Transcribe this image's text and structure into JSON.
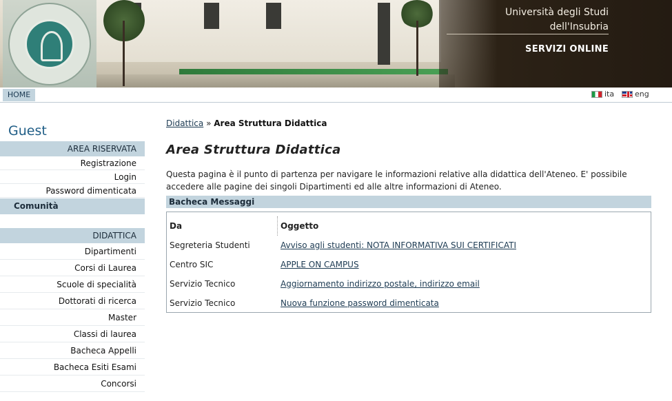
{
  "header": {
    "university_line1": "Università degli Studi",
    "university_line2": "dell'Insubria",
    "services": "SERVIZI ONLINE"
  },
  "nav": {
    "home": "HOME",
    "lang_it": "ita",
    "lang_en": "eng"
  },
  "sidebar": {
    "user": "Guest",
    "area_riservata": "AREA RISERVATA",
    "area_items": [
      "Registrazione",
      "Login",
      "Password dimenticata"
    ],
    "comunita": "Comunità",
    "didattica": "DIDATTICA",
    "didattica_items": [
      "Dipartimenti",
      "Corsi di Laurea",
      "Scuole di specialità",
      "Dottorati di ricerca",
      "Master",
      "Classi di laurea",
      "Bacheca Appelli",
      "Bacheca Esiti Esami",
      "Concorsi"
    ]
  },
  "main": {
    "breadcrumb_link": "Didattica",
    "breadcrumb_sep": "»",
    "breadcrumb_current": "Area Struttura Didattica",
    "title": "Area Struttura Didattica",
    "intro": "Questa pagina è il punto di partenza per navigare le informazioni relative alla didattica dell'Ateneo. E' possibile accedere alle pagine dei singoli Dipartimenti ed alle altre informazioni di Ateneo.",
    "bacheca_title": "Bacheca Messaggi",
    "col_da": "Da",
    "col_oggetto": "Oggetto",
    "messages": [
      {
        "from": "Segreteria Studenti",
        "subject": "Avviso agli studenti: NOTA INFORMATIVA SUI CERTIFICATI"
      },
      {
        "from": "Centro SIC",
        "subject": "APPLE ON CAMPUS"
      },
      {
        "from": "Servizio Tecnico",
        "subject": "Aggiornamento indirizzo postale, indirizzo email"
      },
      {
        "from": "Servizio Tecnico",
        "subject": "Nuova funzione password dimenticata"
      }
    ]
  }
}
